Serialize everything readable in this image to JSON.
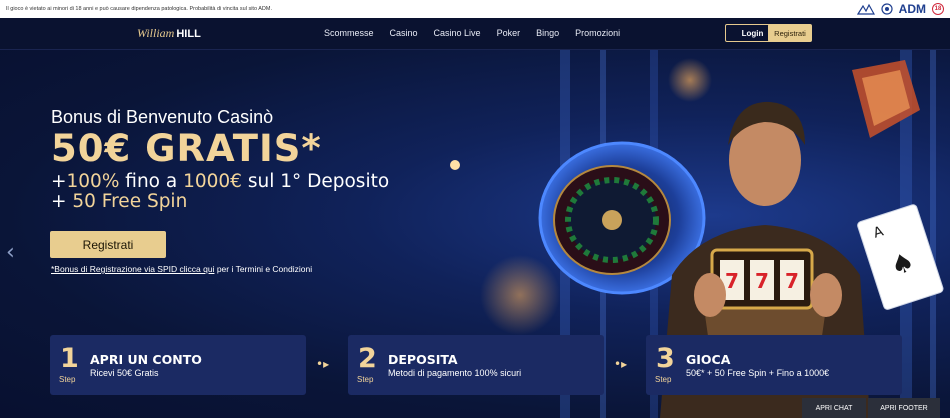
{
  "legal": {
    "text": "Il gioco è vietato ai minori di 18 anni e può causare dipendenza patologica. Probabilità di vincita sul sito ADM.",
    "adm": "ADM",
    "age": "18"
  },
  "nav": {
    "brand_script": "William",
    "brand_bold": "HILL",
    "menu": [
      "Scommesse",
      "Casino",
      "Casino Live",
      "Poker",
      "Bingo",
      "Promozioni"
    ],
    "login": "Login",
    "register": "Registrati"
  },
  "hero": {
    "subtitle": "Bonus di Benvenuto Casinò",
    "headline": "50€ GRATIS*",
    "line1_prefix": "+",
    "line1_pct": "100%",
    "line1_mid": " fino a ",
    "line1_amount": "1000€",
    "line1_suffix": " sul 1° Deposito",
    "line2_prefix": "+ ",
    "line2_spin": "50 Free Spin",
    "cta": "Registrati",
    "terms_link": "*Bonus di Registrazione via SPID clicca qui",
    "terms_rest": " per i Termini e Condizioni"
  },
  "steps": [
    {
      "num": "1",
      "label": "Step",
      "title": "APRI UN CONTO",
      "desc": "Ricevi 50€ Gratis"
    },
    {
      "num": "2",
      "label": "Step",
      "title": "DEPOSITA",
      "desc": "Metodi di pagamento 100% sicuri"
    },
    {
      "num": "3",
      "label": "Step",
      "title": "GIOCA",
      "desc": "50€* + 50 Free Spin + Fino a 1000€"
    }
  ],
  "bottom": {
    "chat": "APRI CHAT",
    "footer": "APRI FOOTER"
  },
  "colors": {
    "gold": "#f2d49a",
    "navy": "#0b1433",
    "step_bg": "#1b2a63"
  }
}
